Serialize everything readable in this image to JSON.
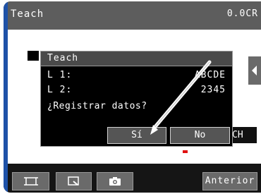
{
  "window": {
    "title": "Teach",
    "coordinate_readout": "0.0CR"
  },
  "dialog": {
    "title": "Teach",
    "rows": [
      {
        "label": "L 1:",
        "value": "ABCDE"
      },
      {
        "label": "L 2:",
        "value": "2345"
      }
    ],
    "question": "¿Registrar datos?",
    "yes_label": "Sí",
    "no_label": "No"
  },
  "side_button_label": "CH",
  "toolbar": {
    "frame_icon": "frame-icon",
    "zoom_icon": "zoom-icon",
    "camera_icon": "camera-icon",
    "back_label": "Anterior"
  },
  "colors": {
    "accent_blue": "#1f52a8",
    "marker_red": "#e01010",
    "titlebar": "#5d5d5d"
  }
}
